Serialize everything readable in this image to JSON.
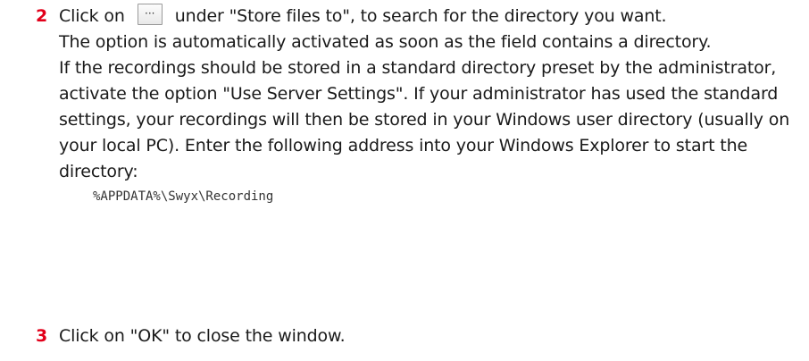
{
  "steps": [
    {
      "number": "2",
      "line1_before": "Click on",
      "button_glyph": "···",
      "line1_after": "under \"Store files to\", to search for the directory you want.",
      "para2": "The option is automatically activated as soon as the field contains a directory.",
      "para3": "If the recordings should be stored in a standard directory preset by the administrator, activate the option \"Use Server Settings\". If your administrator has used the standard settings, your recordings will then be stored in your Windows user directory (usually on your local PC). Enter the following address into your Windows Explorer to start the directory:",
      "code": "%APPDATA%\\Swyx\\Recording"
    },
    {
      "number": "3",
      "text": "Click on \"OK\" to close the window."
    }
  ]
}
